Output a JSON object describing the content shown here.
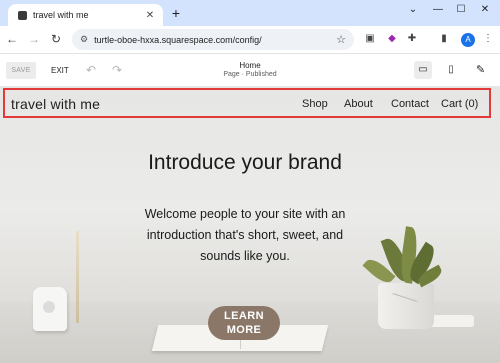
{
  "browser": {
    "tab_title": "travel with me",
    "tab_close": "✕",
    "new_tab": "+",
    "window_controls": [
      "⌄",
      "—",
      "☐",
      "✕"
    ],
    "nav_icons": {
      "back": "←",
      "forward": "→",
      "reload": "↻"
    },
    "url": "turtle-oboe-hxxa.squarespace.com/config/",
    "avatar_letter": "A"
  },
  "editor": {
    "save_label": "SAVE",
    "exit_label": "EXIT",
    "page_title": "Home",
    "page_status": "Page · Published",
    "icons": [
      "undo-icon",
      "redo-icon",
      "desktop-view-icon",
      "mobile-view-icon",
      "site-styles-icon"
    ]
  },
  "site": {
    "logo": "travel with me",
    "nav": {
      "shop": "Shop",
      "about": "About",
      "contact": "Contact",
      "cart": "Cart (0)"
    },
    "hero": {
      "title": "Introduce your brand",
      "body": "Welcome people to your site with an introduction that's short, sweet, and sounds like you.",
      "cta_line1": "LEARN",
      "cta_line2": "MORE"
    }
  },
  "colors": {
    "header_highlight": "#e23a3a",
    "cta_background": "#8a7768",
    "tabstrip": "#d3e3fd",
    "avatar": "#1a73e8"
  }
}
